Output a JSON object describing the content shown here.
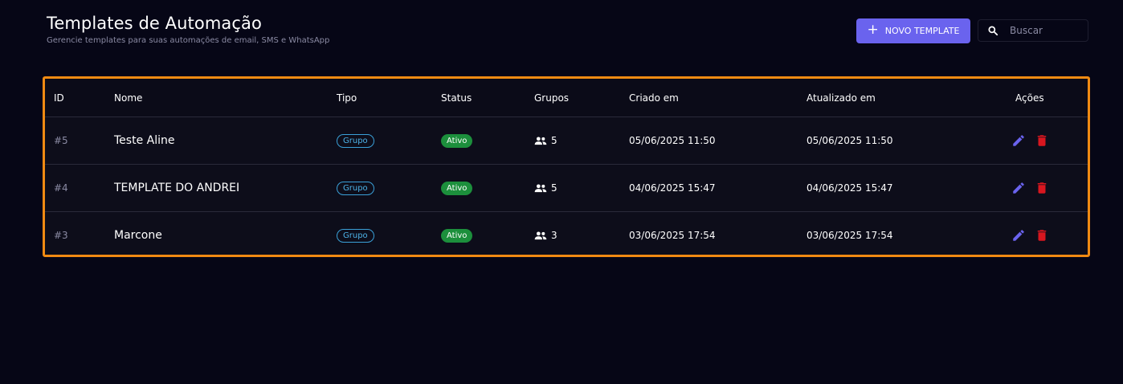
{
  "header": {
    "title": "Templates de Automação",
    "subtitle": "Gerencie templates para suas automações de email, SMS e WhatsApp",
    "new_button_label": "NOVO TEMPLATE",
    "search_placeholder": "Buscar",
    "search_value": ""
  },
  "table": {
    "columns": [
      "ID",
      "Nome",
      "Tipo",
      "Status",
      "Grupos",
      "Criado em",
      "Atualizado em",
      "Ações"
    ],
    "rows": [
      {
        "id": "#5",
        "nome": "Teste Aline",
        "tipo": "Grupo",
        "status": "Ativo",
        "grupos": "5",
        "criado": "05/06/2025 11:50",
        "atualizado": "05/06/2025 11:50"
      },
      {
        "id": "#4",
        "nome": "TEMPLATE DO ANDREI",
        "tipo": "Grupo",
        "status": "Ativo",
        "grupos": "5",
        "criado": "04/06/2025 15:47",
        "atualizado": "04/06/2025 15:47"
      },
      {
        "id": "#3",
        "nome": "Marcone",
        "tipo": "Grupo",
        "status": "Ativo",
        "grupos": "3",
        "criado": "03/06/2025 17:54",
        "atualizado": "03/06/2025 17:54"
      }
    ]
  },
  "icons": {
    "new_button": "plus-icon",
    "search": "search-icon",
    "grupos": "people-icon",
    "edit": "pencil-icon",
    "delete": "trash-icon"
  },
  "colors": {
    "accent": "#6a63ee",
    "highlight_border": "#f08a12",
    "status_active": "#1c8f3c",
    "tipo_chip": "#3aa0d8",
    "delete": "#d8161f",
    "edit": "#6a63ee"
  }
}
